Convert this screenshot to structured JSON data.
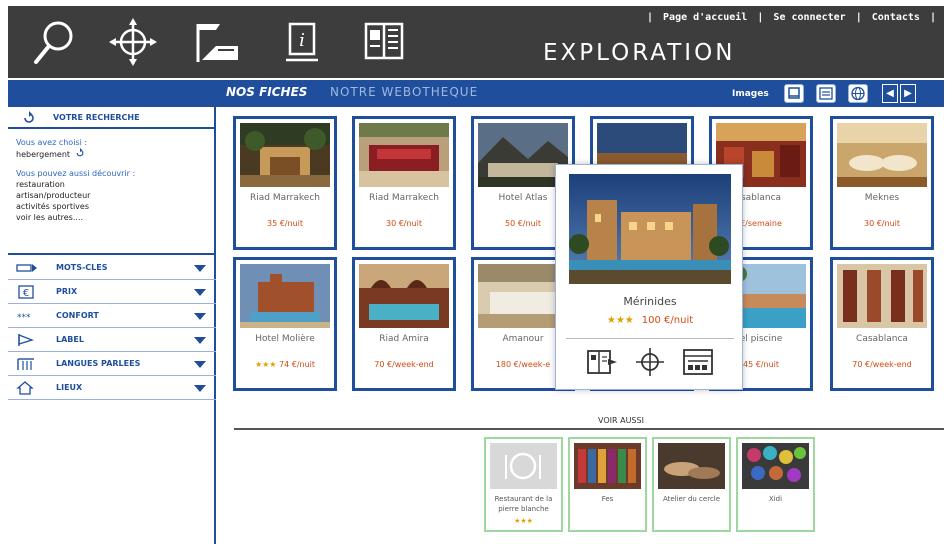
{
  "header": {
    "brand": "EXPLORATION",
    "links": [
      "Page d'accueil",
      "Se connecter",
      "Contacts"
    ],
    "tools": [
      "search-icon",
      "crosshair-icon",
      "route-icon",
      "info-icon",
      "book-icon"
    ]
  },
  "tabs": {
    "active": "NOS FICHES",
    "inactive": "NOTRE WEBOTHEQUE"
  },
  "view": {
    "label": "Images",
    "buttons": [
      "image-view-icon",
      "list-view-icon",
      "globe-view-icon"
    ],
    "prev": "◀",
    "next": "▶"
  },
  "sidebar": {
    "search_title": "VOTRE RECHERCHE",
    "chosen_label": "Vous avez choisi :",
    "chosen_value": "hebergement",
    "discover_label": "Vous pouvez aussi découvrir :",
    "discover_items": [
      "restauration",
      "artisan/producteur",
      "activités sportives",
      "voir les autres...."
    ],
    "facets": [
      {
        "label": "MOTS-CLES",
        "icon": "keyword-icon"
      },
      {
        "label": "PRIX",
        "icon": "euro-icon"
      },
      {
        "label": "CONFORT",
        "icon": "stars-icon"
      },
      {
        "label": "LABEL",
        "icon": "flag-icon"
      },
      {
        "label": "LANGUES PARLEES",
        "icon": "languages-icon"
      },
      {
        "label": "LIEUX",
        "icon": "house-icon"
      }
    ]
  },
  "cards": [
    {
      "name": "Riad Marrakech",
      "stars": "",
      "price": "35 €/nuit"
    },
    {
      "name": "Riad Marrakech",
      "stars": "",
      "price": "30 €/nuit"
    },
    {
      "name": "Hotel Atlas",
      "stars": "",
      "price": "50 €/nuit"
    },
    {
      "name": "",
      "stars": "",
      "price": ""
    },
    {
      "name": "sablanca",
      "stars": "",
      "price": "€/semaine"
    },
    {
      "name": "Meknes",
      "stars": "",
      "price": "30 €/nuit"
    },
    {
      "name": "Hotel Molière",
      "stars": "★★★",
      "price": "74 €/nuit"
    },
    {
      "name": "Riad Amira",
      "stars": "",
      "price": "70 €/week-end"
    },
    {
      "name": "Amanour",
      "stars": "",
      "price": "180 €/week-e"
    },
    {
      "name": "",
      "stars": "",
      "price": ""
    },
    {
      "name": "el piscine",
      "stars": "",
      "price": "45 €/nuit"
    },
    {
      "name": "Casablanca",
      "stars": "",
      "price": "70 €/week-end"
    }
  ],
  "popup": {
    "name": "Mérinides",
    "stars": "★★★",
    "price": "100 €/nuit",
    "actions": [
      "open-sheet-icon",
      "locate-icon",
      "details-icon"
    ]
  },
  "voir_aussi": {
    "title": "VOIR AUSSI",
    "items": [
      {
        "name": "Restaurant de la pierre blanche",
        "stars": "★★★"
      },
      {
        "name": "Fes",
        "stars": ""
      },
      {
        "name": "Atelier du cercle",
        "stars": ""
      },
      {
        "name": "Xidi",
        "stars": ""
      }
    ]
  }
}
